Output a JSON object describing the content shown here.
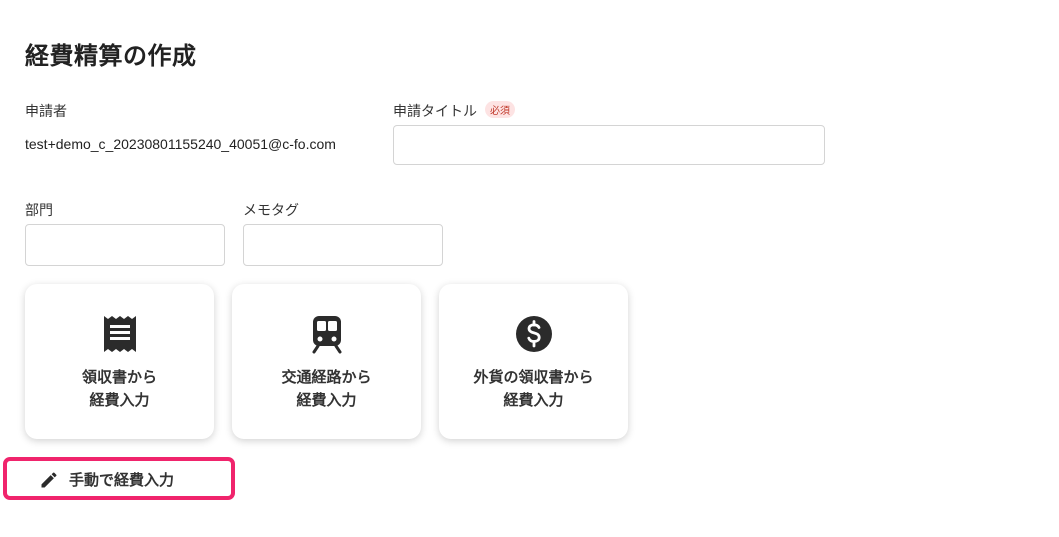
{
  "page": {
    "title": "経費精算の作成"
  },
  "applicant": {
    "label": "申請者",
    "value": "test+demo_c_20230801155240_40051@c-fo.com"
  },
  "request_title": {
    "label": "申請タイトル",
    "required_badge": "必須",
    "value": "",
    "placeholder": ""
  },
  "department": {
    "label": "部門",
    "value": "",
    "placeholder": ""
  },
  "memo_tag": {
    "label": "メモタグ",
    "value": "",
    "placeholder": ""
  },
  "entry_options": [
    {
      "line1": "領収書から",
      "line2": "経費入力",
      "icon": "receipt-icon"
    },
    {
      "line1": "交通経路から",
      "line2": "経費入力",
      "icon": "train-icon"
    },
    {
      "line1": "外貨の領収書から",
      "line2": "経費入力",
      "icon": "dollar-icon"
    }
  ],
  "manual_entry": {
    "label": "手動で経費入力",
    "icon": "pencil-icon",
    "highlight_color": "#f0246c"
  },
  "colors": {
    "icon": "#2b2b2b",
    "required_badge_text": "#c0392b",
    "required_badge_bg": "#fde3e3"
  }
}
